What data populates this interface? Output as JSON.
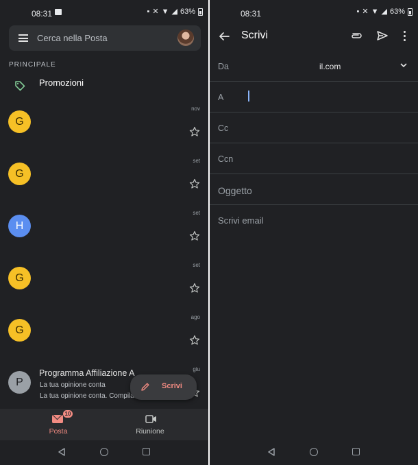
{
  "left": {
    "status": {
      "time": "08:31",
      "battery": "63%"
    },
    "search": {
      "placeholder": "Cerca nella Posta"
    },
    "section_label": "PRINCIPALE",
    "promotions_label": "Promozioni",
    "emails": [
      {
        "avatar": "G",
        "avatar_color": "#f6c026",
        "date": "nov",
        "sender": "",
        "subject": "",
        "snippet": ""
      },
      {
        "avatar": "G",
        "avatar_color": "#f6c026",
        "date": "set",
        "sender": "",
        "subject": "",
        "snippet": ""
      },
      {
        "avatar": "H",
        "avatar_color": "#5b8ef0",
        "date": "set",
        "sender": "",
        "subject": "",
        "snippet": ""
      },
      {
        "avatar": "G",
        "avatar_color": "#f6c026",
        "date": "set",
        "sender": "",
        "subject": "",
        "snippet": ""
      },
      {
        "avatar": "G",
        "avatar_color": "#f6c026",
        "date": "ago",
        "sender": "",
        "subject": "",
        "snippet": ""
      },
      {
        "avatar": "P",
        "avatar_color": "#9aa0a6",
        "date": "giu",
        "sender": "Programma Affiliazione A",
        "subject": "La tua opinione conta",
        "snippet": "La tua opinione conta. Compila il sondaggi..."
      }
    ],
    "fab_label": "Scrivi",
    "nav": {
      "mail_label": "Posta",
      "mail_badge": "10",
      "meet_label": "Riunione"
    }
  },
  "right": {
    "status": {
      "time": "08:31",
      "battery": "63%"
    },
    "compose_title": "Scrivi",
    "fields": {
      "from_label": "Da",
      "from_value": "il.com",
      "to_label": "A",
      "cc_label": "Cc",
      "bcc_label": "Ccn",
      "subject_placeholder": "Oggetto",
      "body_placeholder": "Scrivi email"
    }
  },
  "colors": {
    "background": "#202124",
    "accent": "#f28b82",
    "cursor": "#8ab4f8"
  }
}
